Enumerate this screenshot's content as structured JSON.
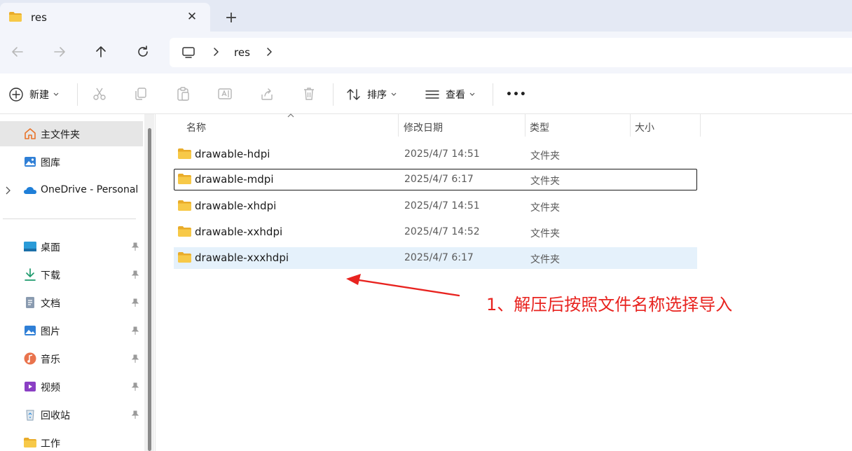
{
  "tab": {
    "title": "res",
    "close_glyph": "✕",
    "new_glyph": "+"
  },
  "address": {
    "segments": [
      "res"
    ]
  },
  "toolbar": {
    "new_label": "新建",
    "sort_label": "排序",
    "view_label": "查看",
    "more_glyph": "•••"
  },
  "sidebar": {
    "items": [
      {
        "label": "主文件夹",
        "icon": "home-icon",
        "selected": true
      },
      {
        "label": "图库",
        "icon": "gallery-icon"
      },
      {
        "label": "OneDrive - Personal",
        "icon": "onedrive-icon"
      },
      {
        "label": "桌面",
        "icon": "desktop-icon"
      },
      {
        "label": "下载",
        "icon": "download-icon"
      },
      {
        "label": "文档",
        "icon": "document-icon"
      },
      {
        "label": "图片",
        "icon": "pictures-icon"
      },
      {
        "label": "音乐",
        "icon": "music-icon"
      },
      {
        "label": "视频",
        "icon": "video-icon"
      },
      {
        "label": "回收站",
        "icon": "recycle-bin-icon"
      },
      {
        "label": "工作",
        "icon": "folder-icon"
      }
    ]
  },
  "columns": {
    "name": "名称",
    "date": "修改日期",
    "type": "类型",
    "size": "大小"
  },
  "files": [
    {
      "name": "drawable-hdpi",
      "date": "2025/4/7 14:51",
      "type": "文件夹"
    },
    {
      "name": "drawable-mdpi",
      "date": "2025/4/7 6:17",
      "type": "文件夹"
    },
    {
      "name": "drawable-xhdpi",
      "date": "2025/4/7 14:51",
      "type": "文件夹"
    },
    {
      "name": "drawable-xxhdpi",
      "date": "2025/4/7 14:52",
      "type": "文件夹"
    },
    {
      "name": "drawable-xxxhdpi",
      "date": "2025/4/7 6:17",
      "type": "文件夹"
    }
  ],
  "annotation": {
    "text": "1、解压后按照文件名称选择导入",
    "color": "#e8231f"
  },
  "colors": {
    "folder": "#f5c342",
    "accent": "#0067c0",
    "selection": "#e5f1fb"
  }
}
